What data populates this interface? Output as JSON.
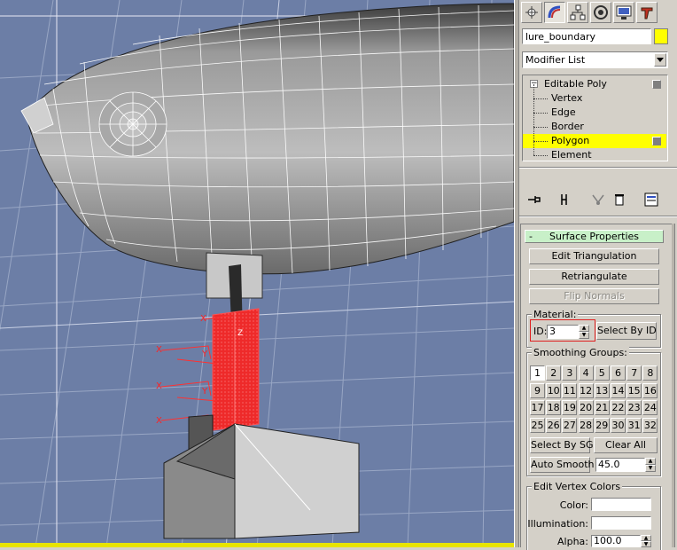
{
  "command_panel": {
    "tabs": [
      {
        "name": "create-tab",
        "icon": "create-icon"
      },
      {
        "name": "modify-tab",
        "icon": "modify-icon",
        "active": true
      },
      {
        "name": "hierarchy-tab",
        "icon": "hierarchy-icon"
      },
      {
        "name": "motion-tab",
        "icon": "motion-icon"
      },
      {
        "name": "display-tab",
        "icon": "display-icon"
      },
      {
        "name": "utilities-tab",
        "icon": "utilities-icon"
      }
    ],
    "object_name": "lure_boundary",
    "object_color": "#ffff00",
    "modifier_list": {
      "selected": "Modifier List"
    },
    "stack": {
      "root": "Editable Poly",
      "subobjects": [
        "Vertex",
        "Edge",
        "Border",
        "Polygon",
        "Element"
      ],
      "selected": "Polygon",
      "highlight_color": "#ffff00"
    },
    "stack_tools": [
      "pin-stack-icon",
      "show-end-result-icon",
      "make-unique-icon",
      "remove-modifier-icon",
      "configure-sets-icon"
    ],
    "rollout": {
      "title": "Surface Properties",
      "toggle": "-",
      "title_color": "#c8f0c8",
      "edit_triangulation": "Edit Triangulation",
      "retriangulate": "Retriangulate",
      "flip_normals": "Flip Normals",
      "material": {
        "label": "Material:",
        "id_label": "ID:",
        "id_value": "3",
        "select_by_id": "Select By ID",
        "highlight_color": "#e02020"
      },
      "smoothing": {
        "label": "Smoothing Groups:",
        "buttons": [
          "1",
          "2",
          "3",
          "4",
          "5",
          "6",
          "7",
          "8",
          "9",
          "10",
          "11",
          "12",
          "13",
          "14",
          "15",
          "16",
          "17",
          "18",
          "19",
          "20",
          "21",
          "22",
          "23",
          "24",
          "25",
          "26",
          "27",
          "28",
          "29",
          "30",
          "31",
          "32"
        ],
        "pressed": [
          "1"
        ],
        "select_by_sg": "Select By SG",
        "clear_all": "Clear All",
        "auto_smooth": "Auto Smooth",
        "auto_smooth_value": "45.0"
      },
      "vertex_colors": {
        "label": "Edit Vertex Colors",
        "color_label": "Color:",
        "illumination_label": "Illumination:",
        "alpha_label": "Alpha:",
        "alpha_value": "100.0"
      }
    }
  },
  "viewport": {
    "background": "#6c7ea6",
    "selection_color": "#ff2020",
    "gizmo_labels": [
      "X",
      "Y",
      "Z"
    ]
  }
}
